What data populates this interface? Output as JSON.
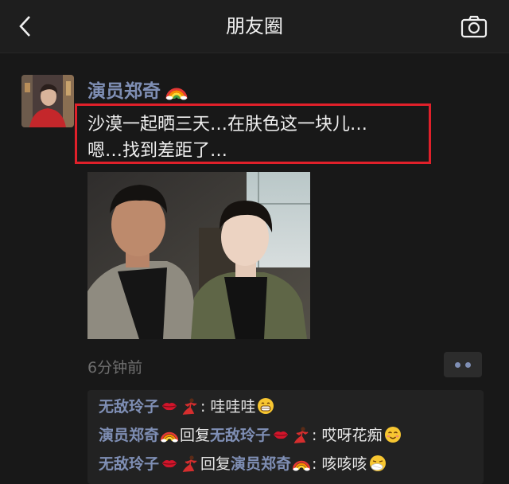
{
  "navbar": {
    "title": "朋友圈"
  },
  "post": {
    "author": "演员郑奇",
    "text_line1": "沙漠一起晒三天…在肤色这一块儿…",
    "text_line2": "嗯…找到差距了…",
    "time": "6分钟前"
  },
  "comments": [
    {
      "name": "无敌玲子",
      "sep": ":",
      "text": "哇哇哇"
    },
    {
      "name": "演员郑奇",
      "reply": "回复",
      "target": "无敌玲子",
      "sep": ":",
      "text": "哎呀花痴"
    },
    {
      "name": "无敌玲子",
      "reply": "回复",
      "target": "演员郑奇",
      "sep": ":",
      "text": "咳咳咳"
    }
  ],
  "icons": {
    "back": "chevron-left-icon",
    "camera": "camera-icon",
    "more": "more-dots-icon",
    "rainbow": "rainbow-emoji",
    "lips": "kiss-lips-emoji",
    "dancer": "dancer-emoji",
    "grin": "grin-emoji",
    "blush": "blush-emoji",
    "cough": "cough-emoji"
  },
  "colors": {
    "background": "#181818",
    "name_blue": "#7f8fb5",
    "highlight_red": "#e0202a"
  }
}
